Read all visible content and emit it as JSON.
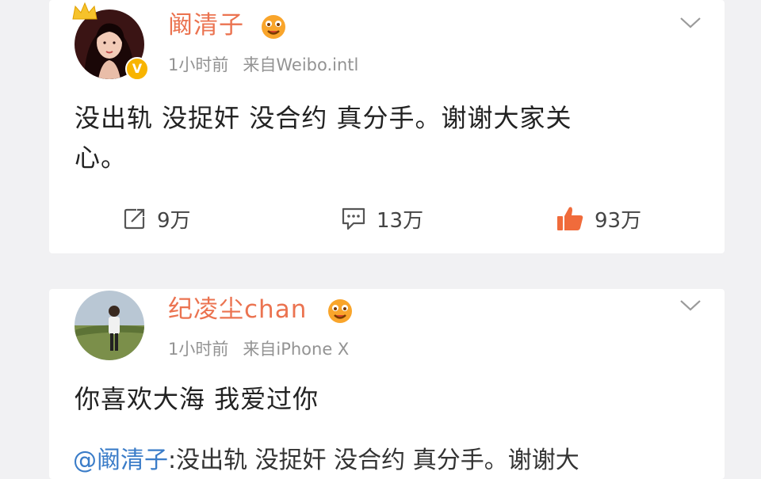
{
  "posts": [
    {
      "username": "阚清子",
      "time": "1小时前",
      "source": "来自Weibo.intl",
      "content_line1": "没出轨 没捉奸 没合约 真分手。谢谢大家关",
      "content_line2": "心。",
      "actions": {
        "repost_count": "9万",
        "comment_count": "13万",
        "like_count": "93万"
      }
    },
    {
      "username": "纪凌尘chan",
      "time": "1小时前",
      "source": "来自iPhone X",
      "content_line1": "你喜欢大海 我爱过你",
      "quote_mention": "@阚清子",
      "quote_text": ":没出轨 没捉奸 没合约 真分手。谢谢大"
    }
  ],
  "colors": {
    "username": "#eb7350",
    "like_icon": "#f06b3b",
    "meta": "#939393",
    "mention": "#3a7cc8"
  }
}
